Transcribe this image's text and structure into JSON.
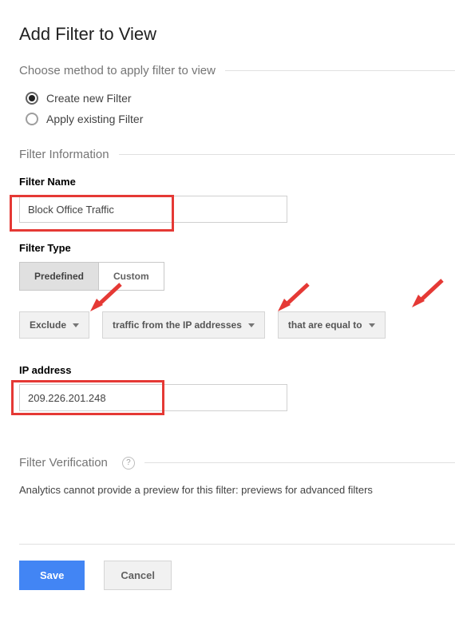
{
  "page_title": "Add Filter to View",
  "method_section": {
    "heading": "Choose method to apply filter to view",
    "option_create": "Create new Filter",
    "option_apply": "Apply existing Filter"
  },
  "filter_info": {
    "heading": "Filter Information",
    "name_label": "Filter Name",
    "name_value": "Block Office Traffic",
    "type_label": "Filter Type",
    "toggle_predefined": "Predefined",
    "toggle_custom": "Custom",
    "dropdown_exclude": "Exclude",
    "dropdown_source": "traffic from the IP addresses",
    "dropdown_expr": "that are equal to",
    "ip_label": "IP address",
    "ip_value": "209.226.201.248"
  },
  "verification": {
    "heading": "Filter Verification",
    "message": "Analytics cannot provide a preview for this filter: previews for advanced filters"
  },
  "buttons": {
    "save": "Save",
    "cancel": "Cancel"
  }
}
